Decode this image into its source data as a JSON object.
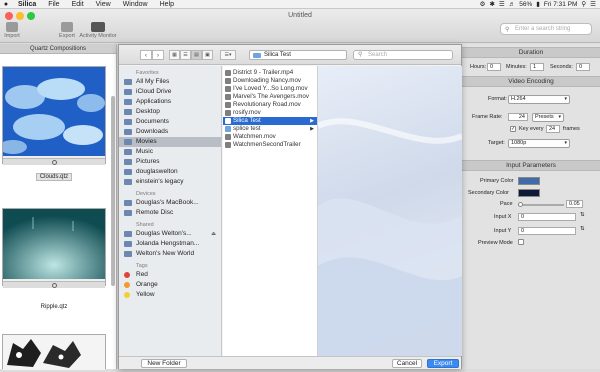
{
  "menubar": {
    "app": "Silica",
    "menus": [
      "File",
      "Edit",
      "View",
      "Window",
      "Help"
    ],
    "battery": "56%",
    "clock": "Fri 7:31 PM"
  },
  "window": {
    "title": "Untitled",
    "toolbar": {
      "import": "Import",
      "export": "Export",
      "activity": "Activity Monitor"
    },
    "search_placeholder": "Enter a search string"
  },
  "compositions": {
    "header": "Quartz Compositions",
    "items": [
      {
        "label": "Clouds.qtz",
        "selected": true
      },
      {
        "label": "Ripple.qtz",
        "selected": false
      }
    ]
  },
  "dialog": {
    "location": "Silica Test",
    "search_placeholder": "Search",
    "sidebar": {
      "favorites_label": "Favorites",
      "favorites": [
        "All My Files",
        "iCloud Drive",
        "Applications",
        "Desktop",
        "Documents",
        "Downloads",
        "Movies",
        "Music",
        "Pictures",
        "douglaswelton",
        "einstein's legacy"
      ],
      "selected": "Movies",
      "devices_label": "Devices",
      "devices": [
        "Douglas's MacBook...",
        "Remote Disc"
      ],
      "shared_label": "Shared",
      "shared": [
        "Douglas Welton's...",
        "Jolanda Hengstman...",
        "Welton's New World"
      ],
      "tags_label": "Tags",
      "tags": [
        {
          "name": "Red",
          "color": "#e2423a"
        },
        {
          "name": "Orange",
          "color": "#f29a2e"
        },
        {
          "name": "Yellow",
          "color": "#f2cf3a"
        }
      ]
    },
    "files": [
      {
        "name": "District 9 - Trailer.mp4",
        "folder": false,
        "selected": false
      },
      {
        "name": "Downloading Nancy.mov",
        "folder": false,
        "selected": false
      },
      {
        "name": "I've Loved Y...So Long.mov",
        "folder": false,
        "selected": false
      },
      {
        "name": "Marvel's The Avengers.mov",
        "folder": false,
        "selected": false
      },
      {
        "name": "Revolutionary Road.mov",
        "folder": false,
        "selected": false
      },
      {
        "name": "rosify.mov",
        "folder": false,
        "selected": false
      },
      {
        "name": "Silica Test",
        "folder": true,
        "selected": true
      },
      {
        "name": "splice test",
        "folder": true,
        "selected": false
      },
      {
        "name": "Watchmen.mov",
        "folder": false,
        "selected": false
      },
      {
        "name": "WatchmenSecondTrailer",
        "folder": false,
        "selected": false
      }
    ],
    "new_folder": "New Folder",
    "cancel": "Cancel",
    "export": "Export"
  },
  "inspector": {
    "duration": {
      "header": "Duration",
      "hours_label": "Hours:",
      "hours": "0",
      "minutes_label": "Minutes:",
      "minutes": "1",
      "seconds_label": "Seconds:",
      "seconds": "0"
    },
    "video": {
      "header": "Video Encoding",
      "format_label": "Format:",
      "format": "H.264",
      "frame_rate_label": "Frame Rate:",
      "frame_rate": "24",
      "presets": "Presets",
      "key_every_label": "Key every",
      "key_every": "24",
      "frames_label": "frames",
      "key_every_checked": true,
      "target_label": "Target:",
      "target": "1080p"
    },
    "input": {
      "header": "Input Parameters",
      "primary_label": "Primary Color",
      "primary_color": "#3f6ca8",
      "secondary_label": "Secondary Color",
      "secondary_color": "#0e1a35",
      "pace_label": "Pace",
      "pace": "0.05",
      "pace_fraction": 0.05,
      "input_x_label": "Input X",
      "input_x": "0",
      "input_y_label": "Input Y",
      "input_y": "0",
      "preview_label": "Preview Mode"
    }
  }
}
